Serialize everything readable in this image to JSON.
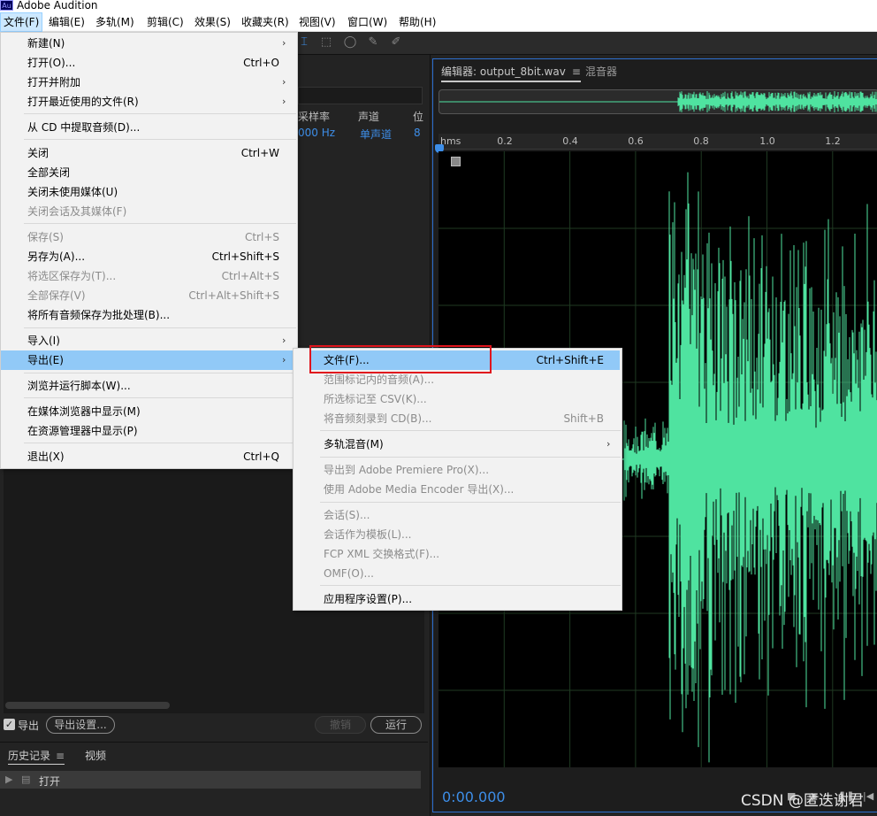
{
  "app": {
    "logo": "Au",
    "title": "Adobe Audition"
  },
  "menubar": [
    "文件(F)",
    "编辑(E)",
    "多轨(M)",
    "剪辑(C)",
    "效果(S)",
    "收藏夹(R)",
    "视图(V)",
    "窗口(W)",
    "帮助(H)"
  ],
  "files_panel": {
    "col_samplerate": "采样率",
    "col_channels": "声道",
    "col_more": "位",
    "row_samplerate": "000 Hz",
    "row_channels": "单声道",
    "row_more": "8"
  },
  "export_row": {
    "checked": true,
    "label": "导出",
    "settings_button": "导出设置...",
    "undo_button": "撤销",
    "run_button": "运行"
  },
  "history_panel": {
    "tab_history": "历史记录",
    "tab_video": "视频",
    "row_label": "打开"
  },
  "editor": {
    "tab_editor": "编辑器: output_8bit.wav",
    "tab_mixer": "混音器",
    "ruler_ticks": [
      "hms",
      "0.2",
      "0.4",
      "0.6",
      "0.8",
      "1.0",
      "1.2"
    ],
    "timecode": "0:00.000",
    "waveform_color": "#4fe3a0"
  },
  "file_menu": {
    "items": [
      {
        "label": "新建(N)",
        "shortcut": "",
        "submenu": true,
        "disabled": false
      },
      {
        "label": "打开(O)...",
        "shortcut": "Ctrl+O",
        "submenu": false,
        "disabled": false
      },
      {
        "label": "打开并附加",
        "shortcut": "",
        "submenu": true,
        "disabled": false
      },
      {
        "label": "打开最近使用的文件(R)",
        "shortcut": "",
        "submenu": true,
        "disabled": false
      },
      {
        "label": "从 CD 中提取音频(D)...",
        "shortcut": "",
        "submenu": false,
        "disabled": false
      },
      {
        "label": "关闭",
        "shortcut": "Ctrl+W",
        "submenu": false,
        "disabled": false
      },
      {
        "label": "全部关闭",
        "shortcut": "",
        "submenu": false,
        "disabled": false
      },
      {
        "label": "关闭未使用媒体(U)",
        "shortcut": "",
        "submenu": false,
        "disabled": false
      },
      {
        "label": "关闭会话及其媒体(F)",
        "shortcut": "",
        "submenu": false,
        "disabled": true
      },
      {
        "label": "保存(S)",
        "shortcut": "Ctrl+S",
        "submenu": false,
        "disabled": true
      },
      {
        "label": "另存为(A)...",
        "shortcut": "Ctrl+Shift+S",
        "submenu": false,
        "disabled": false
      },
      {
        "label": "将选区保存为(T)...",
        "shortcut": "Ctrl+Alt+S",
        "submenu": false,
        "disabled": true
      },
      {
        "label": "全部保存(V)",
        "shortcut": "Ctrl+Alt+Shift+S",
        "submenu": false,
        "disabled": true
      },
      {
        "label": "将所有音频保存为批处理(B)...",
        "shortcut": "",
        "submenu": false,
        "disabled": false
      },
      {
        "label": "导入(I)",
        "shortcut": "",
        "submenu": true,
        "disabled": false
      },
      {
        "label": "导出(E)",
        "shortcut": "",
        "submenu": true,
        "disabled": false
      },
      {
        "label": "浏览并运行脚本(W)...",
        "shortcut": "",
        "submenu": false,
        "disabled": false
      },
      {
        "label": "在媒体浏览器中显示(M)",
        "shortcut": "",
        "submenu": false,
        "disabled": false
      },
      {
        "label": "在资源管理器中显示(P)",
        "shortcut": "",
        "submenu": false,
        "disabled": false
      },
      {
        "label": "退出(X)",
        "shortcut": "Ctrl+Q",
        "submenu": false,
        "disabled": false
      }
    ]
  },
  "export_submenu": {
    "items": [
      {
        "label": "文件(F)...",
        "shortcut": "Ctrl+Shift+E",
        "submenu": false,
        "disabled": false
      },
      {
        "label": "范围标记内的音频(A)...",
        "shortcut": "",
        "submenu": false,
        "disabled": true
      },
      {
        "label": "所选标记至 CSV(K)...",
        "shortcut": "",
        "submenu": false,
        "disabled": true
      },
      {
        "label": "将音频刻录到 CD(B)...",
        "shortcut": "Shift+B",
        "submenu": false,
        "disabled": true
      },
      {
        "label": "多轨混音(M)",
        "shortcut": "",
        "submenu": true,
        "disabled": false
      },
      {
        "label": "导出到 Adobe Premiere Pro(X)...",
        "shortcut": "",
        "submenu": false,
        "disabled": true
      },
      {
        "label": "使用 Adobe Media Encoder 导出(X)...",
        "shortcut": "",
        "submenu": false,
        "disabled": true
      },
      {
        "label": "会话(S)...",
        "shortcut": "",
        "submenu": false,
        "disabled": true
      },
      {
        "label": "会话作为模板(L)...",
        "shortcut": "",
        "submenu": false,
        "disabled": true
      },
      {
        "label": "FCP XML 交换格式(F)...",
        "shortcut": "",
        "submenu": false,
        "disabled": true
      },
      {
        "label": "OMF(O)...",
        "shortcut": "",
        "submenu": false,
        "disabled": true
      },
      {
        "label": "应用程序设置(P)...",
        "shortcut": "",
        "submenu": false,
        "disabled": false
      }
    ]
  },
  "watermark": "CSDN @匿迭谢君"
}
